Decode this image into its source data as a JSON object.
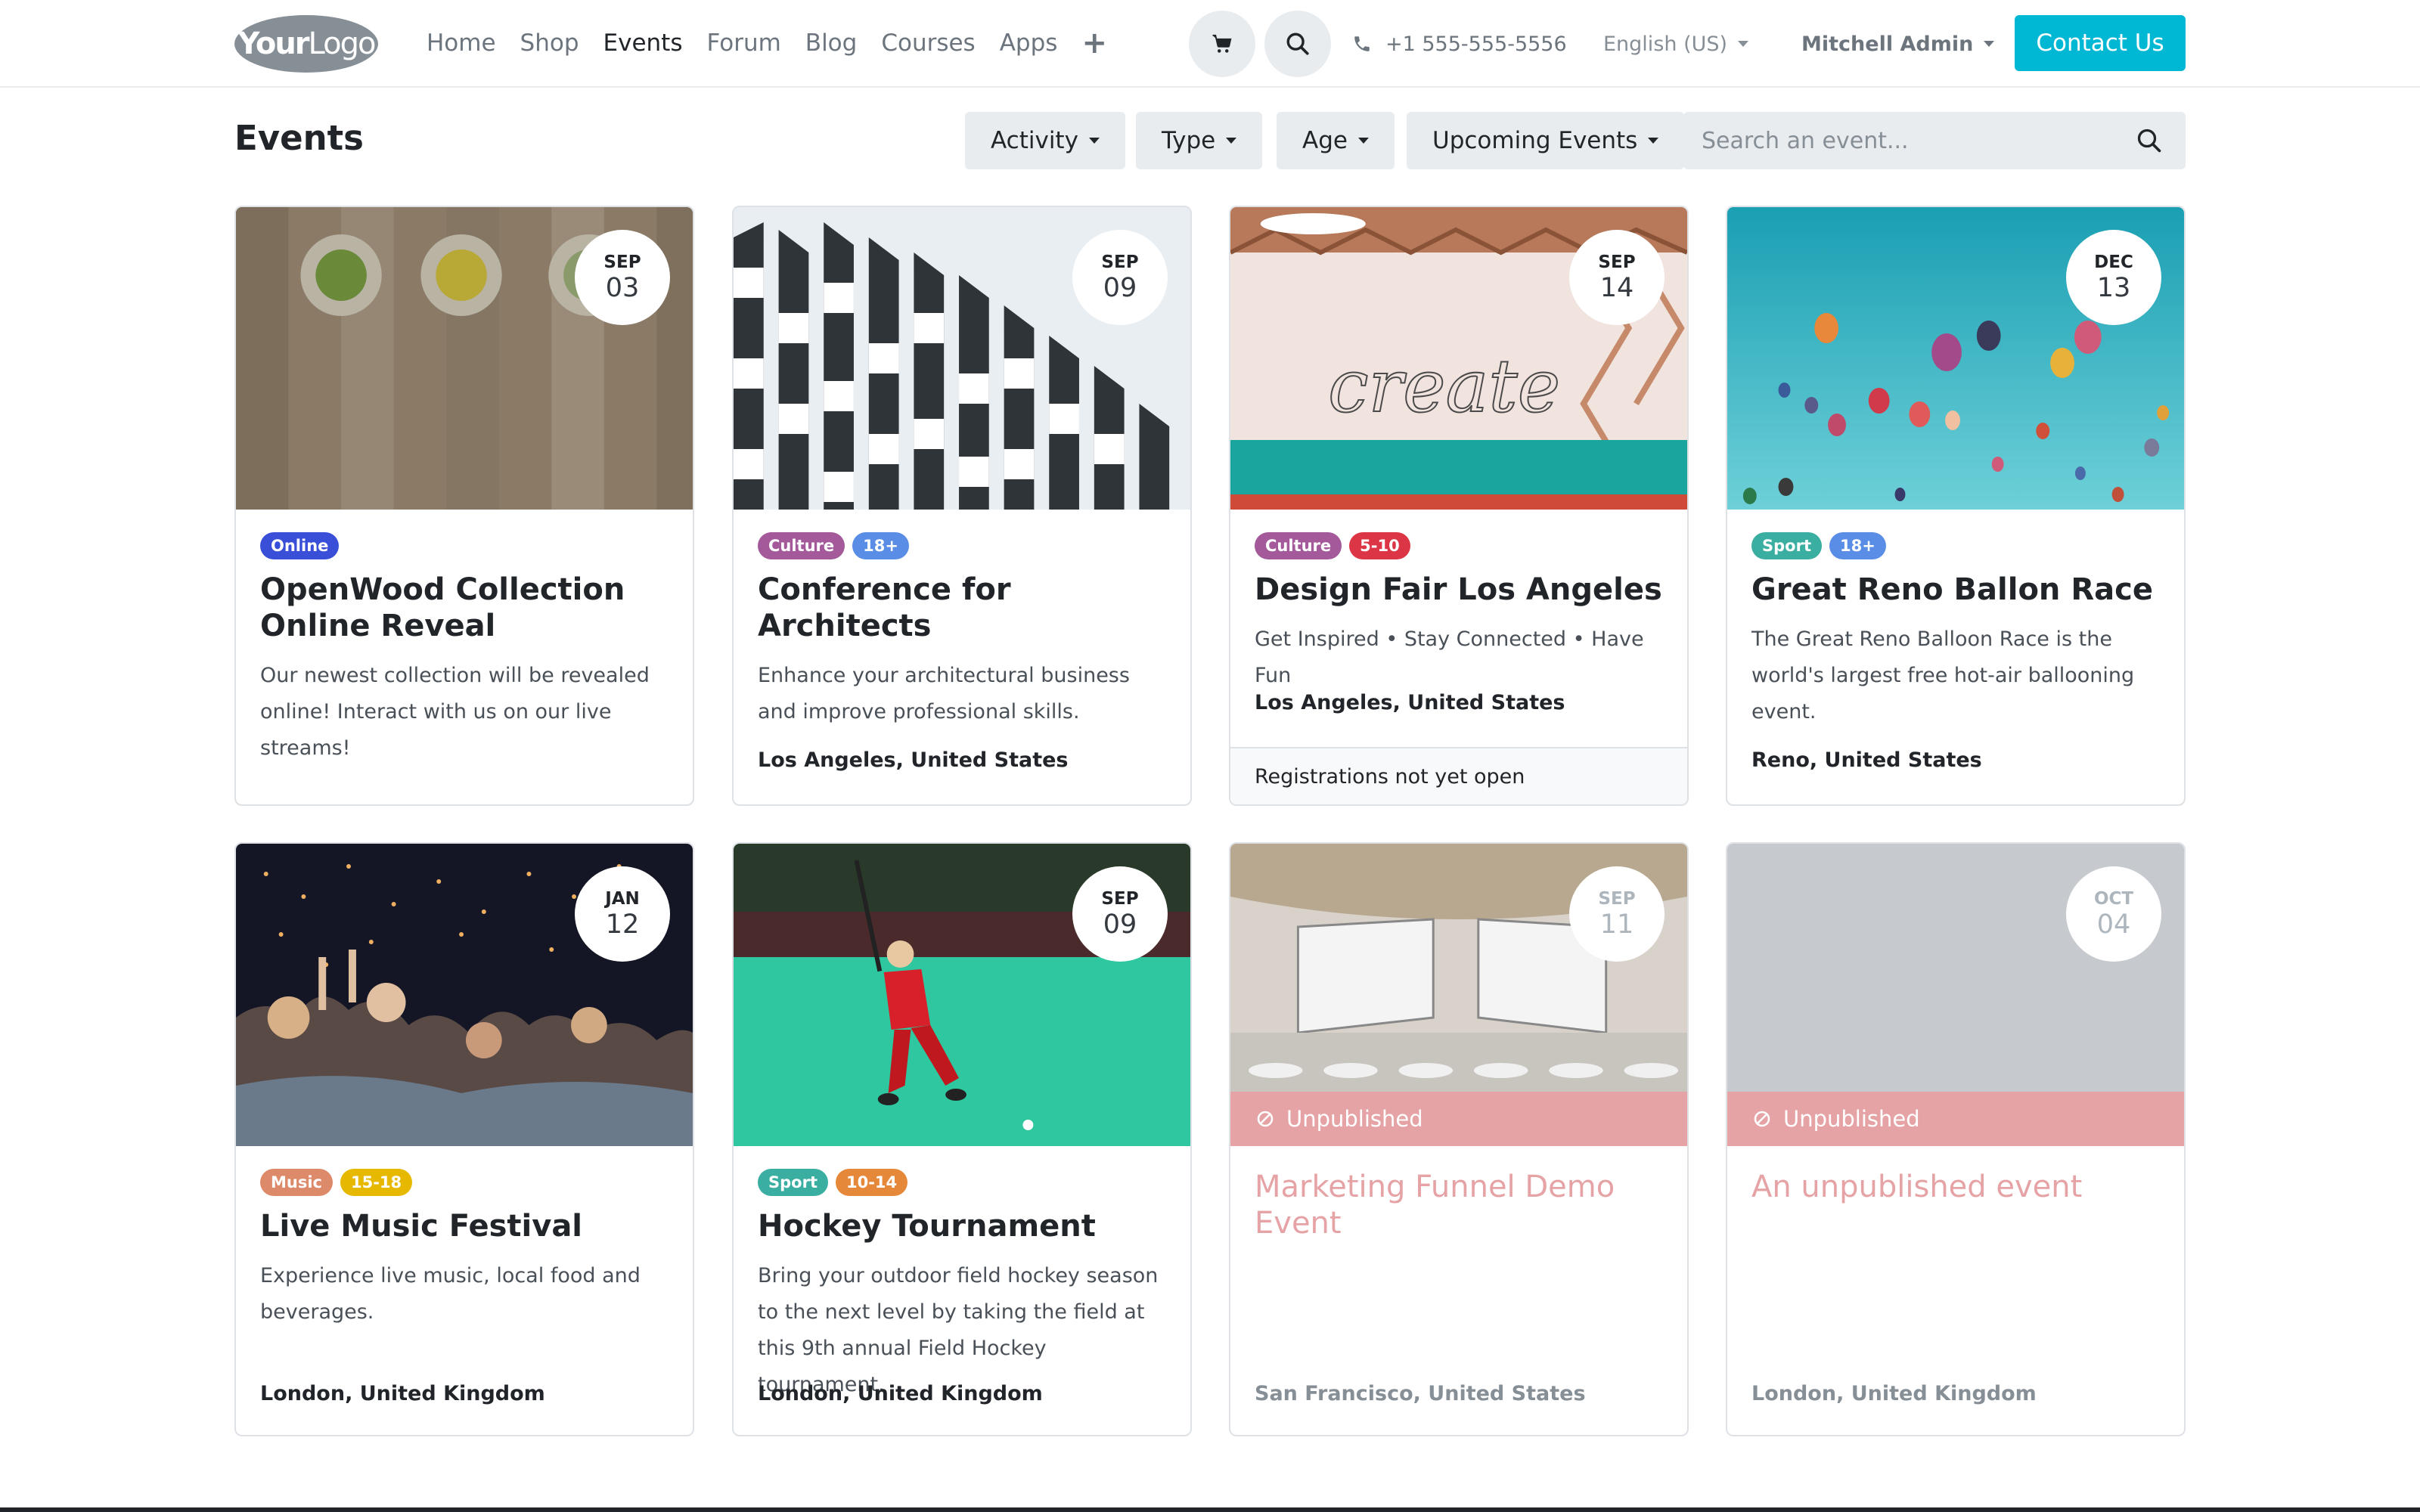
{
  "nav": {
    "logo_bold": "Your",
    "logo_thin": "Logo",
    "menu": [
      "Home",
      "Shop",
      "Events",
      "Forum",
      "Blog",
      "Courses",
      "Apps"
    ],
    "active": "Events",
    "phone": "+1 555-555-5556",
    "language": "English (US)",
    "user": "Mitchell Admin",
    "contact": "Contact Us"
  },
  "page": {
    "title": "Events",
    "filters": [
      "Activity",
      "Type",
      "Age",
      "Upcoming Events"
    ],
    "search_placeholder": "Search an event..."
  },
  "colors": {
    "accent": "#00b8d4",
    "online": "#3a4fd8",
    "culture": "#a3599a",
    "age_blue": "#5a8ee6",
    "age_red": "#dc3545",
    "sport": "#3aaea0",
    "music": "#dc8a6a",
    "age_yellow": "#e6b800",
    "age_orange": "#e6883a",
    "unpublished": "#e6a3a6"
  },
  "events": [
    {
      "month": "SEP",
      "day": "03",
      "badges": [
        "Online"
      ],
      "title": "OpenWood Collection Online Reveal",
      "description": "Our newest collection will be revealed online! Interact with us on our live streams!",
      "location": "",
      "footer": "",
      "published": true
    },
    {
      "month": "SEP",
      "day": "09",
      "badges": [
        "Culture",
        "18+"
      ],
      "title": "Conference for Architects",
      "description": "Enhance your architectural business and improve professional skills.",
      "location": "Los Angeles, United States",
      "footer": "",
      "published": true
    },
    {
      "month": "SEP",
      "day": "14",
      "badges": [
        "Culture",
        "5-10"
      ],
      "title": "Design Fair Los Angeles",
      "description": "Get Inspired • Stay Connected • Have Fun",
      "location": "Los Angeles, United States",
      "footer": "Registrations not yet open",
      "published": true
    },
    {
      "month": "DEC",
      "day": "13",
      "badges": [
        "Sport",
        "18+"
      ],
      "title": "Great Reno Ballon Race",
      "description": "The Great Reno Balloon Race is the world's largest free hot-air ballooning event.",
      "location": "Reno, United States",
      "footer": "",
      "published": true
    },
    {
      "month": "JAN",
      "day": "12",
      "badges": [
        "Music",
        "15-18"
      ],
      "title": "Live Music Festival",
      "description": "Experience live music, local food and beverages.",
      "location": "London, United Kingdom",
      "footer": "",
      "published": true
    },
    {
      "month": "SEP",
      "day": "09",
      "badges": [
        "Sport",
        "10-14"
      ],
      "title": "Hockey Tournament",
      "description": "Bring your outdoor field hockey season to the next level by taking the field at this 9th annual Field Hockey tournament.",
      "location": "London, United Kingdom",
      "footer": "",
      "published": true
    },
    {
      "month": "SEP",
      "day": "11",
      "badges": [],
      "title": "Marketing Funnel Demo Event",
      "description": "",
      "location": "San Francisco, United States",
      "footer": "",
      "published": false,
      "status": "Unpublished"
    },
    {
      "month": "OCT",
      "day": "04",
      "badges": [],
      "title": "An unpublished event",
      "description": "",
      "location": "London, United Kingdom",
      "footer": "",
      "published": false,
      "status": "Unpublished"
    }
  ]
}
